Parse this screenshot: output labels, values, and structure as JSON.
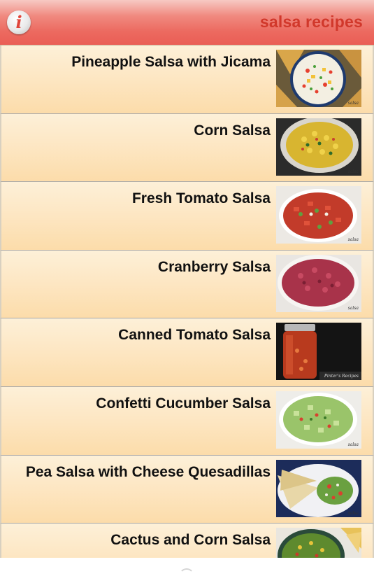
{
  "header": {
    "title": "salsa recipes",
    "info_icon": "info-icon",
    "colors": {
      "bar": "#ec6a60",
      "title": "#d1382b",
      "info_glyph": "#e0453a"
    }
  },
  "recipes": [
    {
      "title": "Pineapple Salsa with Jicama",
      "thumb": "pineapple-jicama-salsa-photo"
    },
    {
      "title": "Corn Salsa",
      "thumb": "corn-salsa-photo"
    },
    {
      "title": "Fresh Tomato Salsa",
      "thumb": "fresh-tomato-salsa-photo"
    },
    {
      "title": "Cranberry Salsa",
      "thumb": "cranberry-salsa-photo"
    },
    {
      "title": "Canned Tomato Salsa",
      "thumb": "canned-tomato-salsa-photo"
    },
    {
      "title": "Confetti Cucumber Salsa",
      "thumb": "confetti-cucumber-salsa-photo"
    },
    {
      "title": "Pea Salsa with Cheese Quesadillas",
      "thumb": "pea-salsa-quesadillas-photo"
    },
    {
      "title": "Cactus and Corn Salsa",
      "thumb": "cactus-corn-salsa-photo"
    }
  ],
  "watermarks": {
    "default": "salsa",
    "canned": "Pinter's Recipes"
  },
  "list_colors": {
    "row_top": "#fdf0d8",
    "row_bottom": "#fcdcaa",
    "divider": "#a8a8a8",
    "text": "#111111"
  },
  "loading_indicator": "spinner-icon"
}
